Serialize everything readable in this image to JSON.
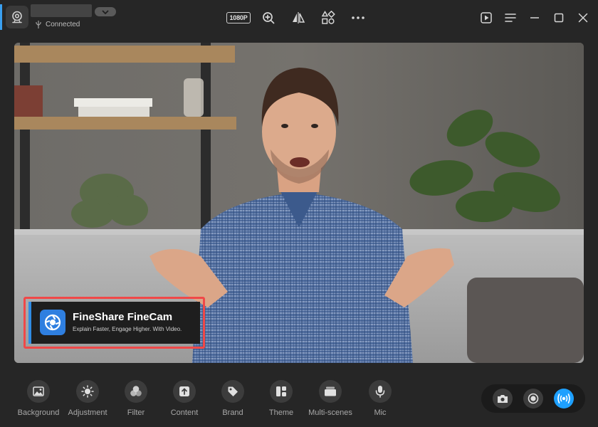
{
  "header": {
    "connection_status": "Connected",
    "resolution_badge": "1080P",
    "accent_color": "#3aa0f0"
  },
  "overlay": {
    "title": "FineShare FineCam",
    "subtitle": "Explain Faster, Engage Higher. With Video.",
    "highlight_color": "#f04848"
  },
  "features": [
    {
      "label": "Background",
      "icon": "image-icon"
    },
    {
      "label": "Adjustment",
      "icon": "brightness-icon"
    },
    {
      "label": "Filter",
      "icon": "filter-icon"
    },
    {
      "label": "Content",
      "icon": "upload-icon"
    },
    {
      "label": "Brand",
      "icon": "tag-icon"
    },
    {
      "label": "Theme",
      "icon": "layout-icon"
    },
    {
      "label": "Multi-scenes",
      "icon": "scenes-icon"
    },
    {
      "label": "Mic",
      "icon": "microphone-icon"
    }
  ],
  "capture": {
    "live_color": "#1ea0ff"
  }
}
